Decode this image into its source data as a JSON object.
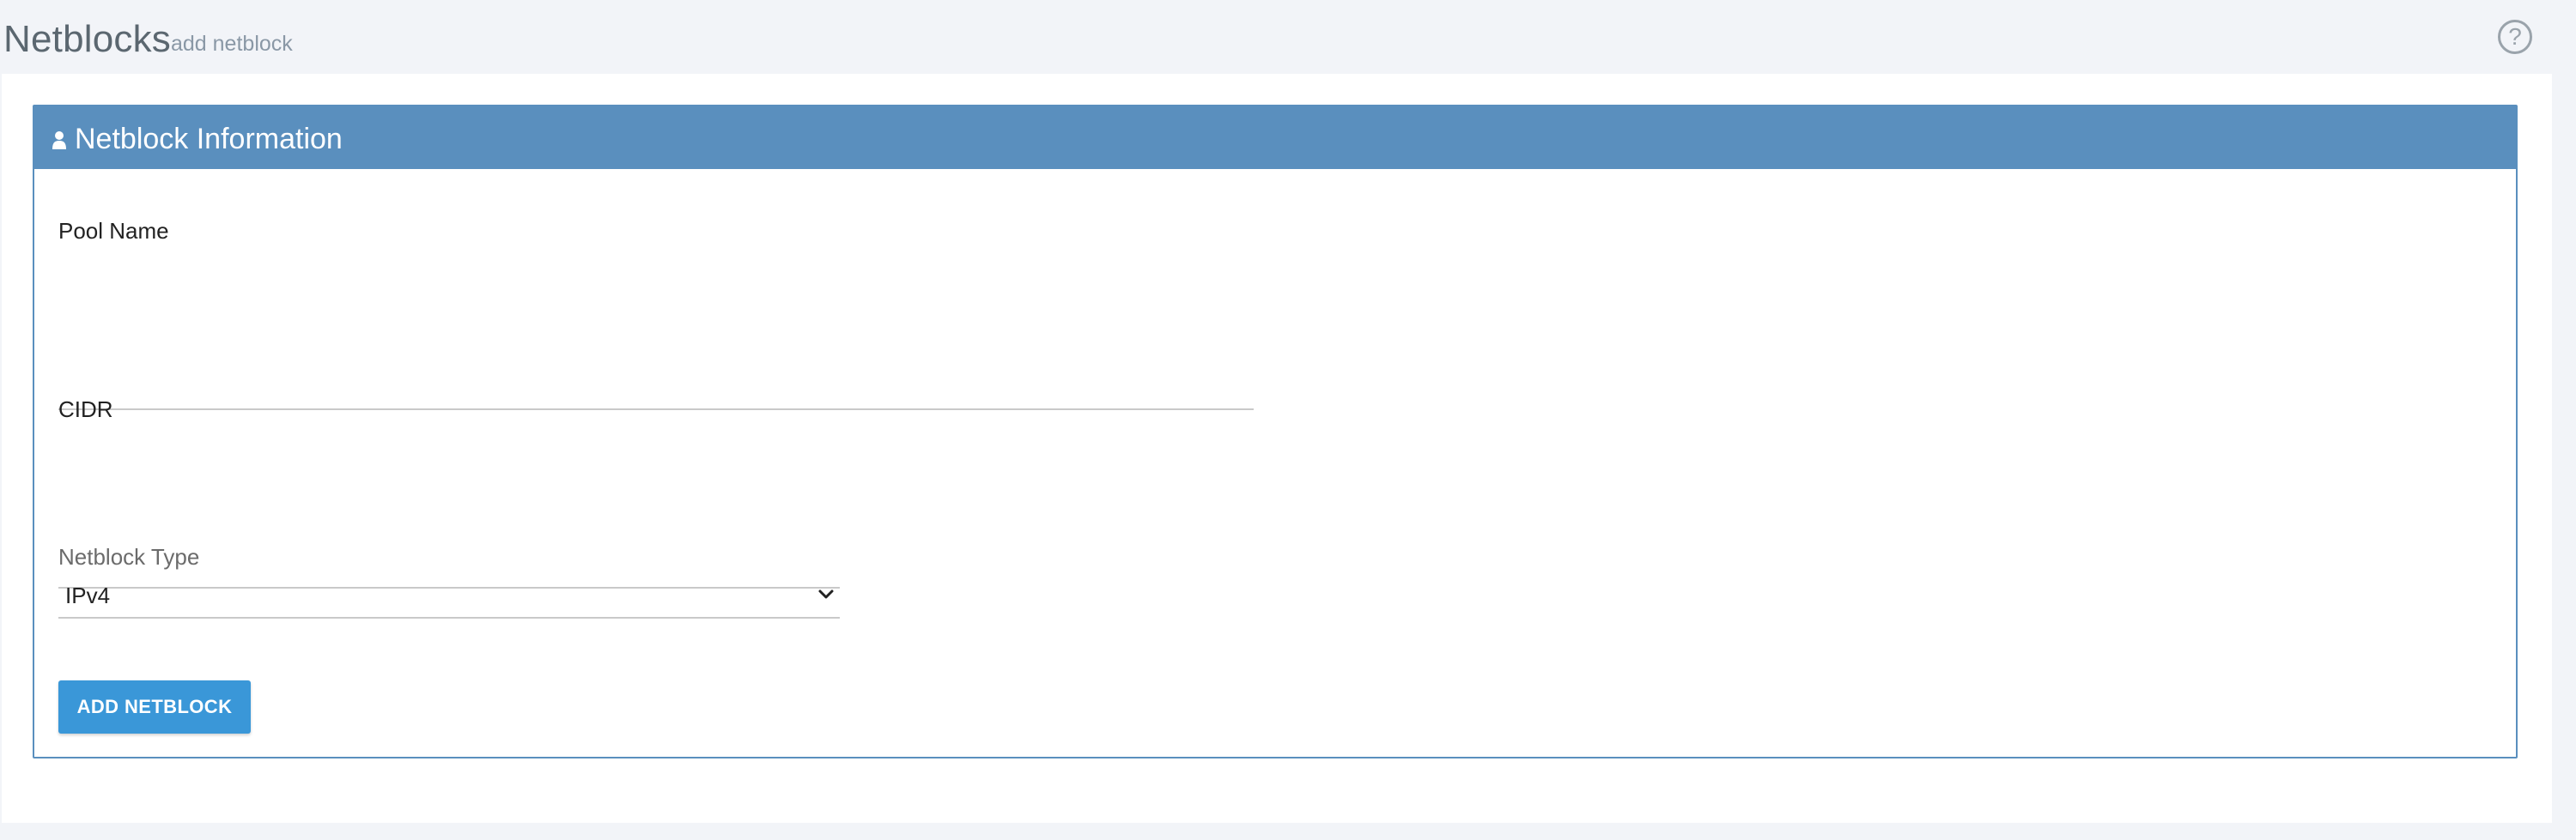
{
  "header": {
    "title": "Netblocks",
    "subtitle": "add netblock",
    "help_icon": "question-circle-icon",
    "help_glyph": "?"
  },
  "panel": {
    "title": "Netblock Information",
    "icon": "user-icon",
    "heading_color": "#5a8fbe"
  },
  "form": {
    "pool_name": {
      "label": "Pool Name",
      "value": ""
    },
    "cidr": {
      "label": "CIDR",
      "value": ""
    },
    "netblock_type": {
      "label": "Netblock Type",
      "selected": "IPv4",
      "icon": "chevron-down-icon"
    },
    "submit_label": "ADD NETBLOCK"
  },
  "colors": {
    "button": "#3a97d8",
    "background": "#f2f4f8"
  }
}
